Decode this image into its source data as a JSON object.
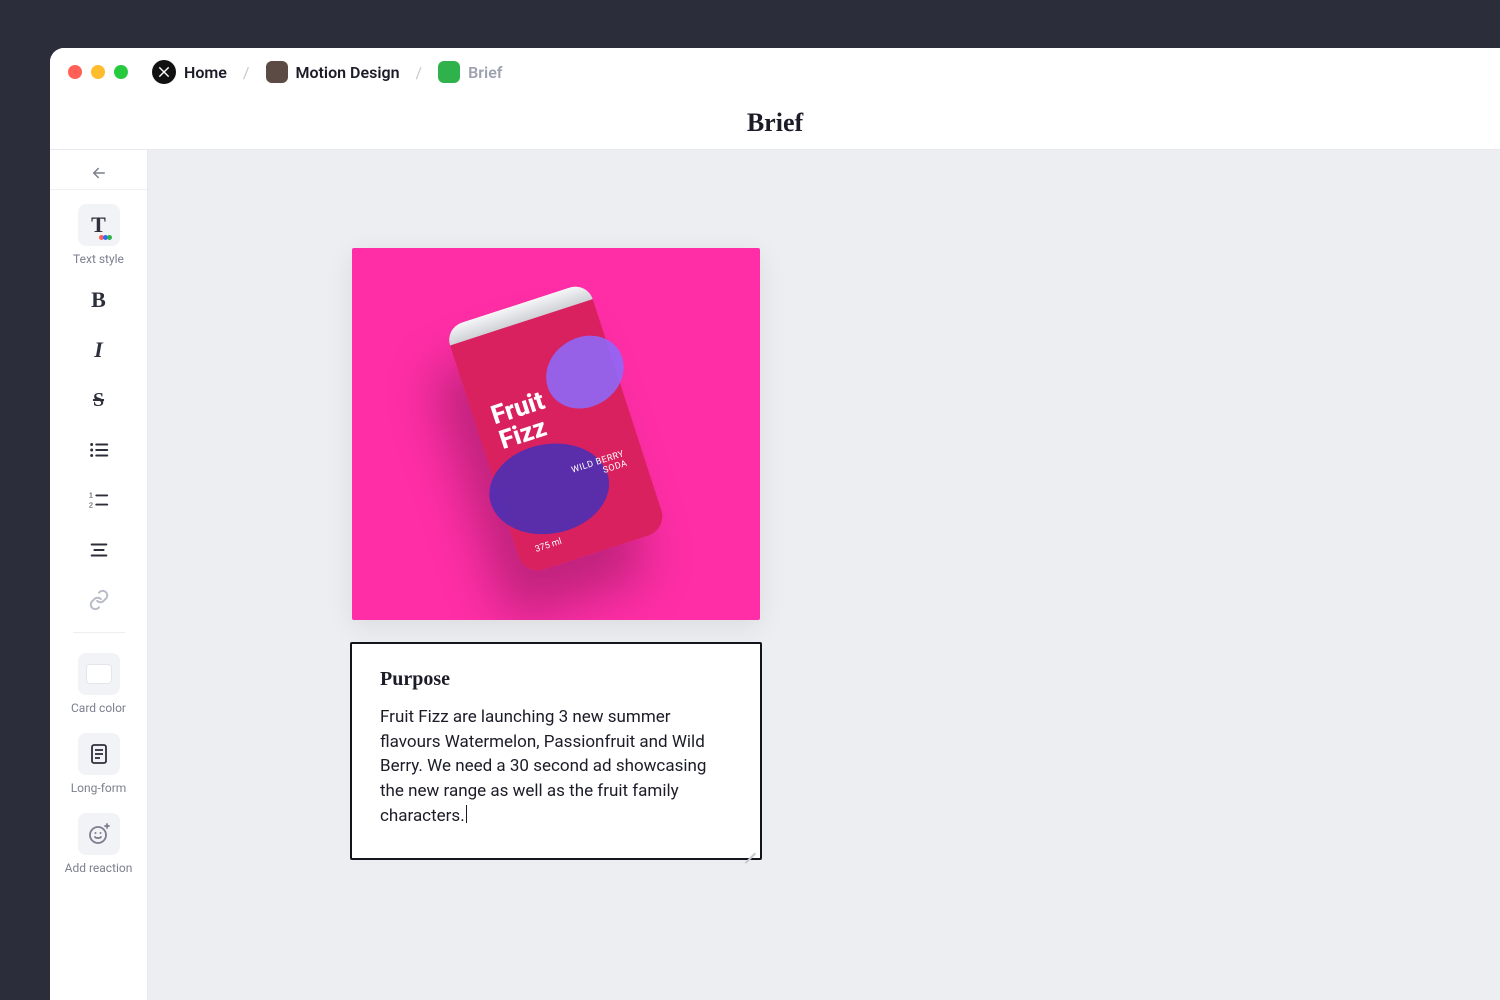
{
  "breadcrumb": {
    "home": "Home",
    "project": "Motion Design",
    "page": "Brief"
  },
  "page_title": "Brief",
  "sidebar": {
    "text_style_label": "Text style",
    "card_color_label": "Card color",
    "long_form_label": "Long-form",
    "add_reaction_label": "Add reaction"
  },
  "image_card": {
    "brand_line1": "Fruit",
    "brand_line2": "Fizz",
    "sub_line1": "WILD BERRY",
    "sub_line2": "SODA",
    "volume": "375 ml"
  },
  "text_card": {
    "heading": "Purpose",
    "body": "Fruit Fizz are launching 3 new summer flavours Watermelon, Passionfruit and Wild Berry. We need a 30 second ad showcasing the new range as well as the fruit family characters."
  }
}
